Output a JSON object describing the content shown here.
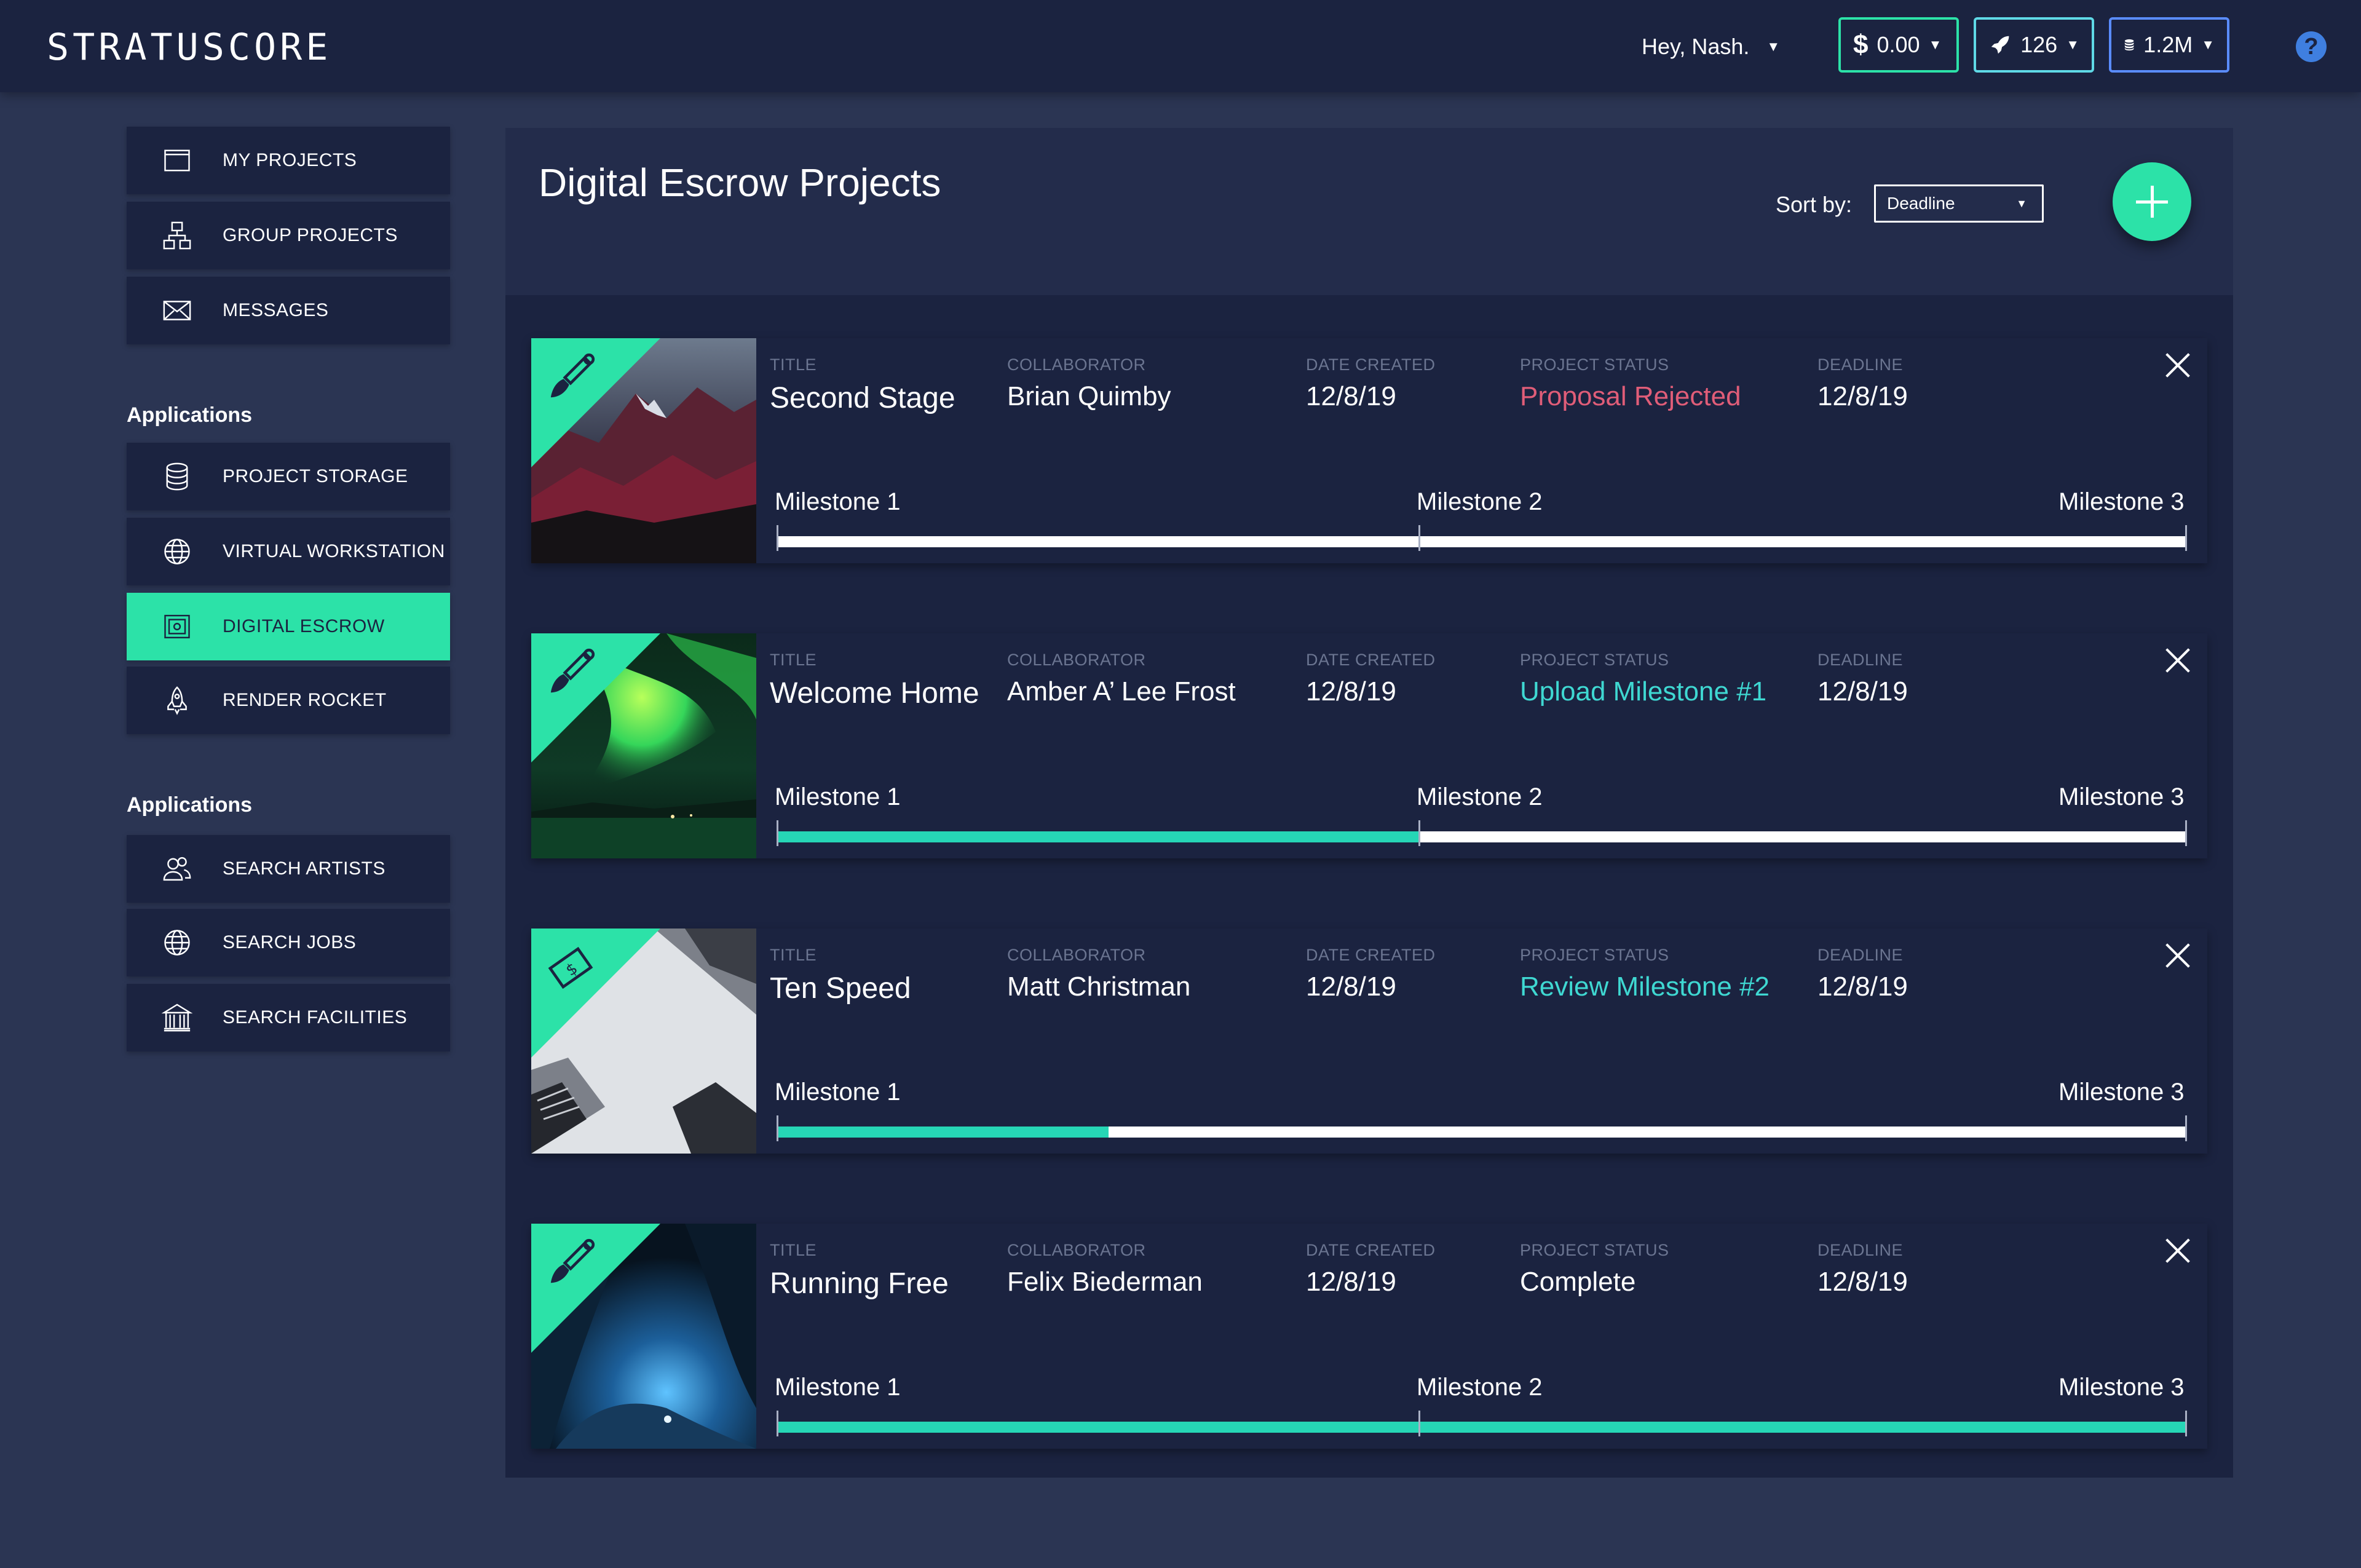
{
  "header": {
    "logo": "STRATUSCORE",
    "greeting": "Hey, Nash.",
    "balance": "$",
    "balance_value": "0.00",
    "rockets": "126",
    "storage": "1.2M",
    "help": "?"
  },
  "sidebar": {
    "items_top": [
      {
        "label": "MY PROJECTS",
        "icon": "folder-icon"
      },
      {
        "label": "GROUP PROJECTS",
        "icon": "hierarchy-icon"
      },
      {
        "label": "MESSAGES",
        "icon": "envelope-icon"
      }
    ],
    "heading_apps_1": "Applications",
    "items_apps_1": [
      {
        "label": "PROJECT STORAGE",
        "icon": "database-icon"
      },
      {
        "label": "VIRTUAL WORKSTATION",
        "icon": "globe-icon"
      },
      {
        "label": "DIGITAL ESCROW",
        "icon": "safe-icon",
        "active": true
      },
      {
        "label": "RENDER ROCKET",
        "icon": "rocket-icon"
      }
    ],
    "heading_apps_2": "Applications",
    "items_apps_2": [
      {
        "label": "SEARCH ARTISTS",
        "icon": "users-icon"
      },
      {
        "label": "SEARCH JOBS",
        "icon": "globe-icon"
      },
      {
        "label": "SEARCH FACILITIES",
        "icon": "building-icon"
      }
    ]
  },
  "main": {
    "title": "Digital Escrow Projects",
    "sort_label": "Sort by:",
    "sort_value": "Deadline"
  },
  "columns": {
    "title": "TITLE",
    "collaborator": "COLLABORATOR",
    "date_created": "DATE CREATED",
    "status": "PROJECT STATUS",
    "deadline": "DEADLINE"
  },
  "projects": [
    {
      "title": "Second Stage",
      "collaborator": "Brian Quimby",
      "date_created": "12/8/19",
      "status": "Proposal Rejected",
      "deadline": "12/8/19",
      "type_icon": "paintbrush-icon",
      "milestones": [
        "Milestone 1",
        "Milestone 2",
        "Milestone 3"
      ],
      "progress": 0.0
    },
    {
      "title": "Welcome Home",
      "collaborator": "Amber A’ Lee Frost",
      "date_created": "12/8/19",
      "status": "Upload Milestone #1",
      "deadline": "12/8/19",
      "type_icon": "paintbrush-icon",
      "milestones": [
        "Milestone 1",
        "Milestone 2",
        "Milestone 3"
      ],
      "progress": 0.456
    },
    {
      "title": "Ten Speed",
      "collaborator": "Matt Christman",
      "date_created": "12/8/19",
      "status": "Review Milestone #2",
      "deadline": "12/8/19",
      "type_icon": "dollar-bill-icon",
      "milestones": [
        "Milestone 1",
        "Milestone 3"
      ],
      "progress": 0.235
    },
    {
      "title": "Running Free",
      "collaborator": "Felix Biederman",
      "date_created": "12/8/19",
      "status": "Complete",
      "deadline": "12/8/19",
      "type_icon": "paintbrush-icon",
      "milestones": [
        "Milestone 1",
        "Milestone 2",
        "Milestone 3"
      ],
      "progress": 1.0
    }
  ],
  "colors": {
    "accent": "#2ce2a8",
    "rejected": "#e05d78",
    "teal_status": "#3fd8d2",
    "panel": "#1b2340",
    "background": "#2b3553"
  }
}
